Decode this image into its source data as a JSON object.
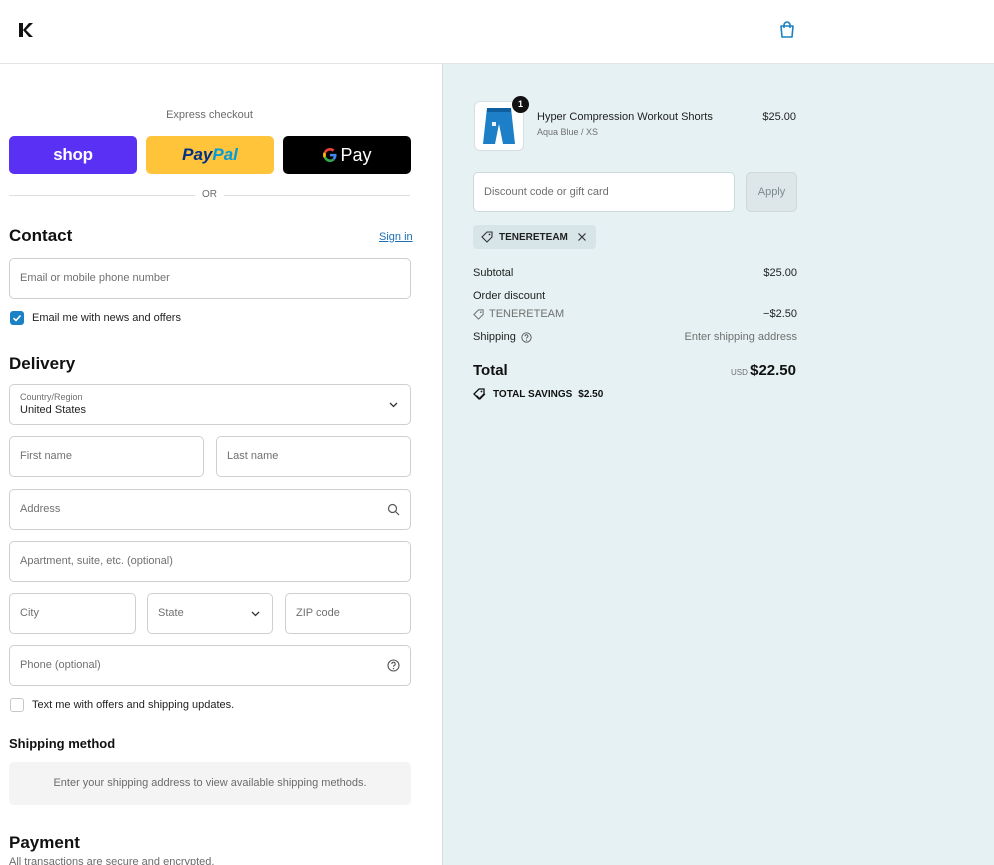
{
  "colors": {
    "shop": "#5a31f4",
    "paypal": "#ffc439",
    "gpay": "#000000",
    "accent": "#1a82c4",
    "summary_bg": "#e6f1f3"
  },
  "header": {
    "logo_icon": "brand-k-logo-icon",
    "cart_icon": "shopping-bag-icon"
  },
  "express": {
    "label": "Express checkout",
    "shop_label": "shop",
    "paypal_a": "Pay",
    "paypal_b": "Pal",
    "gpay_label": "Pay",
    "or_label": "OR"
  },
  "contact": {
    "title": "Contact",
    "signin": "Sign in",
    "email_placeholder": "Email or mobile phone number",
    "newsletter_label": "Email me with news and offers",
    "newsletter_checked": true
  },
  "delivery": {
    "title": "Delivery",
    "country_label": "Country/Region",
    "country_value": "United States",
    "first_name": "First name",
    "last_name": "Last name",
    "address": "Address",
    "apartment": "Apartment, suite, etc. (optional)",
    "city": "City",
    "state": "State",
    "zip": "ZIP code",
    "phone": "Phone (optional)",
    "sms_label": "Text me with offers and shipping updates.",
    "sms_checked": false
  },
  "shipping_method": {
    "title": "Shipping method",
    "note": "Enter your shipping address to view available shipping methods."
  },
  "payment": {
    "title": "Payment",
    "note": "All transactions are secure and encrypted."
  },
  "summary": {
    "product": {
      "title": "Hyper Compression Workout Shorts",
      "variant": "Aqua Blue / XS",
      "price": "$25.00",
      "quantity": "1"
    },
    "discount_placeholder": "Discount code or gift card",
    "apply_label": "Apply",
    "applied_code": "TENERETEAM",
    "subtotal_label": "Subtotal",
    "subtotal_value": "$25.00",
    "order_discount_label": "Order discount",
    "discount_code": "TENERETEAM",
    "discount_value": "−$2.50",
    "shipping_label": "Shipping",
    "shipping_value": "Enter shipping address",
    "total_label": "Total",
    "currency": "USD",
    "total_value": "$22.50",
    "savings_label": "TOTAL SAVINGS",
    "savings_value": "$2.50"
  }
}
